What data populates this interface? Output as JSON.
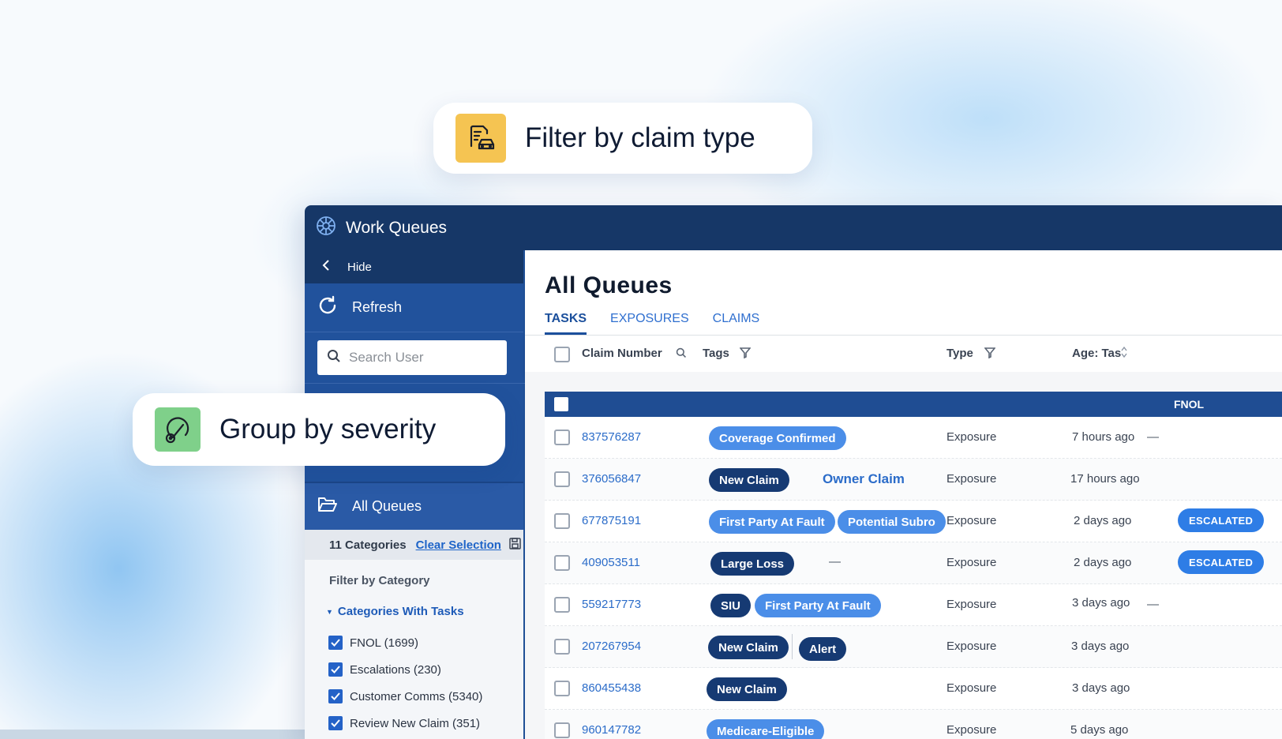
{
  "callouts": {
    "filter": {
      "text": "Filter by claim type",
      "icon": "car-document-icon"
    },
    "group": {
      "text": "Group by severity",
      "icon": "severity-gauge-icon"
    }
  },
  "app": {
    "title": "Work Queues",
    "logo_icon": "wheel-logo-icon"
  },
  "sidebar": {
    "hide_label": "Hide",
    "refresh_label": "Refresh",
    "search_placeholder": "Search User",
    "all_queues_label": "All Queues",
    "categories_count": "11 Categories",
    "clear_selection": "Clear Selection",
    "filter_by_category": "Filter by Category",
    "categories_with_tasks": "Categories With Tasks",
    "categories": [
      {
        "label": "FNOL (1699)",
        "checked": true
      },
      {
        "label": "Escalations (230)",
        "checked": true
      },
      {
        "label": "Customer Comms (5340)",
        "checked": true
      },
      {
        "label": "Review New Claim (351)",
        "checked": true
      }
    ]
  },
  "main": {
    "title": "All Queues",
    "tabs": [
      {
        "label": "TASKS",
        "active": true
      },
      {
        "label": "EXPOSURES",
        "active": false
      },
      {
        "label": "CLAIMS",
        "active": false
      }
    ],
    "columns": {
      "claim_number": "Claim Number",
      "tags": "Tags",
      "type": "Type",
      "age": "Age: Tas"
    },
    "group_label": "FNOL",
    "rows": [
      {
        "claim": "837576287",
        "tags": [
          "Coverage Confirmed"
        ],
        "type": "Exposure",
        "age": "7 hours ago",
        "extra": "—"
      },
      {
        "claim": "376056847",
        "tags": [
          "New Claim"
        ],
        "owner": "Owner Claim",
        "type": "Exposure",
        "age": "17 hours ago"
      },
      {
        "claim": "677875191",
        "tags": [
          "First Party At Fault",
          "Potential Subro"
        ],
        "type": "Exposure",
        "age": "2 days ago",
        "status": "ESCALATED"
      },
      {
        "claim": "409053511",
        "tags": [
          "Large Loss"
        ],
        "tag_dash": "—",
        "type": "Exposure",
        "age": "2 days ago",
        "status": "ESCALATED"
      },
      {
        "claim": "559217773",
        "tags": [
          "SIU",
          "First Party At Fault"
        ],
        "type": "Exposure",
        "age": "3 days ago",
        "extra": "—"
      },
      {
        "claim": "207267954",
        "tags": [
          "New Claim",
          "Alert"
        ],
        "type": "Exposure",
        "age": "3 days ago"
      },
      {
        "claim": "860455438",
        "tags": [
          "New Claim"
        ],
        "type": "Exposure",
        "age": "3 days ago"
      },
      {
        "claim": "960147782",
        "tags": [
          "Medicare-Eligible"
        ],
        "type": "Exposure",
        "age": "5 days ago"
      }
    ]
  }
}
